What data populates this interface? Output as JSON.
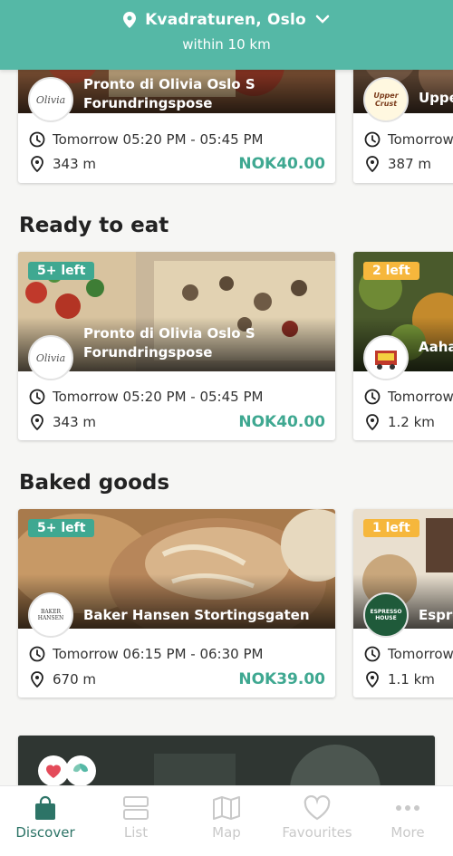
{
  "header": {
    "location": "Kvadraturen, Oslo",
    "radius": "within 10 km"
  },
  "top_row": {
    "cards": [
      {
        "store": "Pronto di Olivia Oslo S",
        "bag": "Forundringspose",
        "time": "Tomorrow 05:20 PM - 05:45 PM",
        "distance": "343 m",
        "price": "NOK40.00",
        "logo_text": "Olivia"
      },
      {
        "store": "Uppe",
        "time": "Tomorrow",
        "distance": "387 m",
        "logo_text": "Upper Crust"
      }
    ]
  },
  "ready_to_eat": {
    "title": "Ready to eat",
    "cards": [
      {
        "badge": "5+ left",
        "store": "Pronto di Olivia Oslo S",
        "bag": "Forundringspose",
        "time": "Tomorrow 05:20 PM - 05:45 PM",
        "distance": "343 m",
        "price": "NOK40.00",
        "logo_text": "Olivia"
      },
      {
        "badge": "2 left",
        "store": "Aaha",
        "time": "Tomorrow",
        "distance": "1.2 km"
      }
    ]
  },
  "baked_goods": {
    "title": "Baked goods",
    "cards": [
      {
        "badge": "5+ left",
        "store": "Baker Hansen Stortingsgaten",
        "time": "Tomorrow 06:15 PM - 06:30 PM",
        "distance": "670 m",
        "price": "NOK39.00",
        "logo_text": "BAKER HANSEN"
      },
      {
        "badge": "1 left",
        "store": "Espre",
        "time": "Tomorrow",
        "distance": "1.1 km",
        "logo_text": "ESPRESSO HOUSE"
      }
    ]
  },
  "tabs": [
    {
      "label": "Discover",
      "icon": "bag-icon",
      "active": true
    },
    {
      "label": "List",
      "icon": "list-icon",
      "active": false
    },
    {
      "label": "Map",
      "icon": "map-icon",
      "active": false
    },
    {
      "label": "Favourites",
      "icon": "heart-icon",
      "active": false
    },
    {
      "label": "More",
      "icon": "more-icon",
      "active": false
    }
  ],
  "colors": {
    "brand": "#55b8a6",
    "price": "#3fa891",
    "badge_green": "#3fa891",
    "badge_yellow": "#f6b73c",
    "tab_active": "#2d7467"
  }
}
